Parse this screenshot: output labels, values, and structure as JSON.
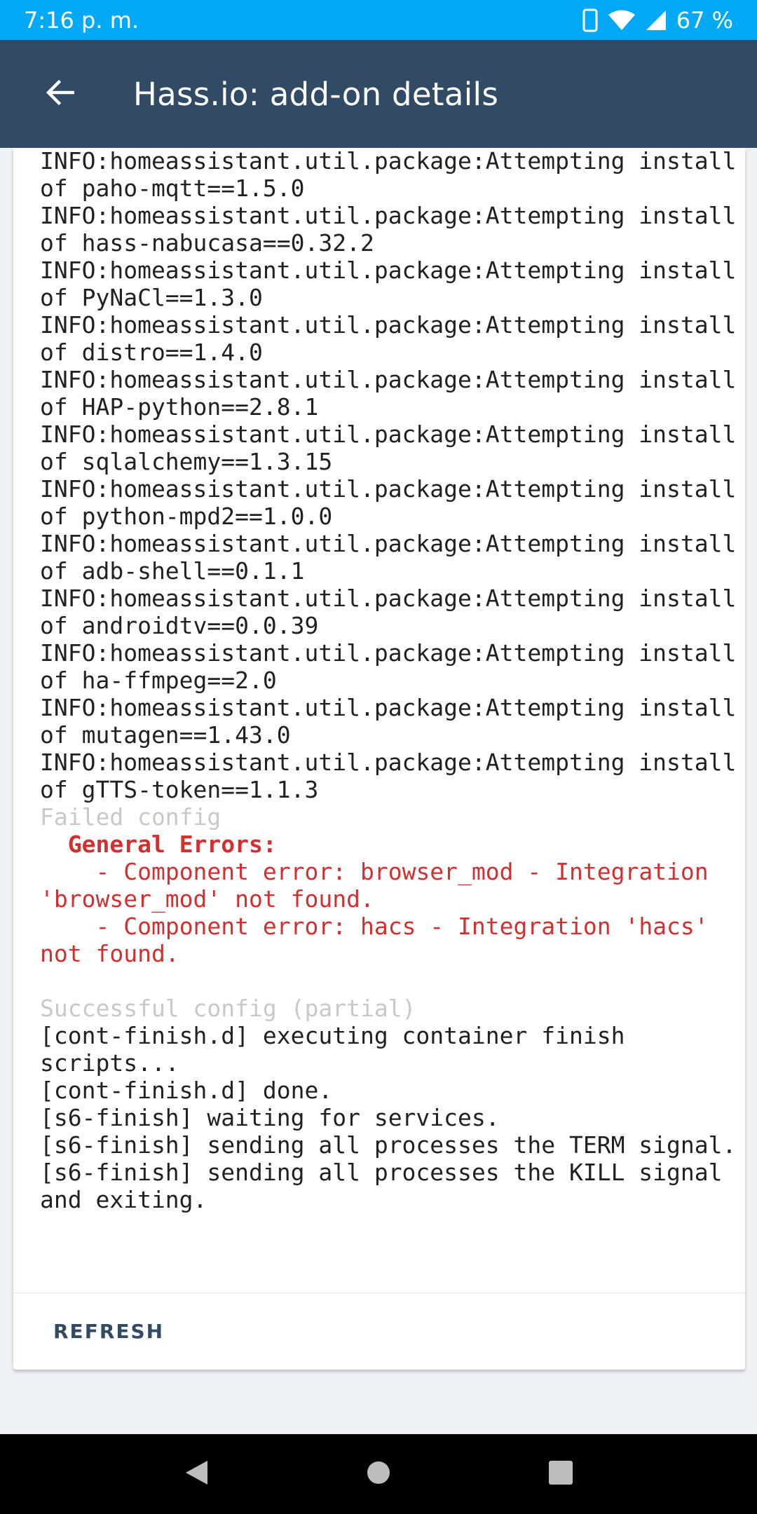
{
  "status_bar": {
    "time": "7:16 p. m.",
    "battery": "67 %",
    "icons": [
      "phone-icon",
      "wifi-icon",
      "signal-icon"
    ]
  },
  "app_bar": {
    "title": "Hass.io: add-on details",
    "back_icon": "arrow-left-icon"
  },
  "log": {
    "lines": [
      {
        "text": "INFO:homeassistant.util.package:Attempting install of paho-mqtt==1.5.0",
        "style": "normal"
      },
      {
        "text": "INFO:homeassistant.util.package:Attempting install of hass-nabucasa==0.32.2",
        "style": "normal"
      },
      {
        "text": "INFO:homeassistant.util.package:Attempting install of PyNaCl==1.3.0",
        "style": "normal"
      },
      {
        "text": "INFO:homeassistant.util.package:Attempting install of distro==1.4.0",
        "style": "normal"
      },
      {
        "text": "INFO:homeassistant.util.package:Attempting install of HAP-python==2.8.1",
        "style": "normal"
      },
      {
        "text": "INFO:homeassistant.util.package:Attempting install of sqlalchemy==1.3.15",
        "style": "normal"
      },
      {
        "text": "INFO:homeassistant.util.package:Attempting install of python-mpd2==1.0.0",
        "style": "normal"
      },
      {
        "text": "INFO:homeassistant.util.package:Attempting install of adb-shell==0.1.1",
        "style": "normal"
      },
      {
        "text": "INFO:homeassistant.util.package:Attempting install of androidtv==0.0.39",
        "style": "normal"
      },
      {
        "text": "INFO:homeassistant.util.package:Attempting install of ha-ffmpeg==2.0",
        "style": "normal"
      },
      {
        "text": "INFO:homeassistant.util.package:Attempting install of mutagen==1.43.0",
        "style": "normal"
      },
      {
        "text": "INFO:homeassistant.util.package:Attempting install of gTTS-token==1.1.3",
        "style": "normal"
      },
      {
        "text": "Failed config",
        "style": "faded"
      },
      {
        "text": "  General Errors:",
        "style": "error-bold"
      },
      {
        "text": "    - Component error: browser_mod - Integration 'browser_mod' not found.",
        "style": "error"
      },
      {
        "text": "    - Component error: hacs - Integration 'hacs' not found.",
        "style": "error"
      },
      {
        "text": " ",
        "style": "normal"
      },
      {
        "text": "Successful config (partial)",
        "style": "faded"
      },
      {
        "text": "[cont-finish.d] executing container finish scripts...",
        "style": "normal"
      },
      {
        "text": "[cont-finish.d] done.",
        "style": "normal"
      },
      {
        "text": "[s6-finish] waiting for services.",
        "style": "normal"
      },
      {
        "text": "[s6-finish] sending all processes the TERM signal.",
        "style": "normal"
      },
      {
        "text": "[s6-finish] sending all processes the KILL signal and exiting.",
        "style": "normal"
      }
    ]
  },
  "actions": {
    "refresh_label": "REFRESH"
  },
  "nav_bar": {
    "icons": [
      "back-triangle-icon",
      "home-circle-icon",
      "recents-square-icon"
    ]
  },
  "colors": {
    "status_bar": "#03a9f4",
    "app_bar": "#324b65",
    "error": "#d32f2f",
    "faded": "#c8c8c8",
    "background": "#eef1f5"
  }
}
